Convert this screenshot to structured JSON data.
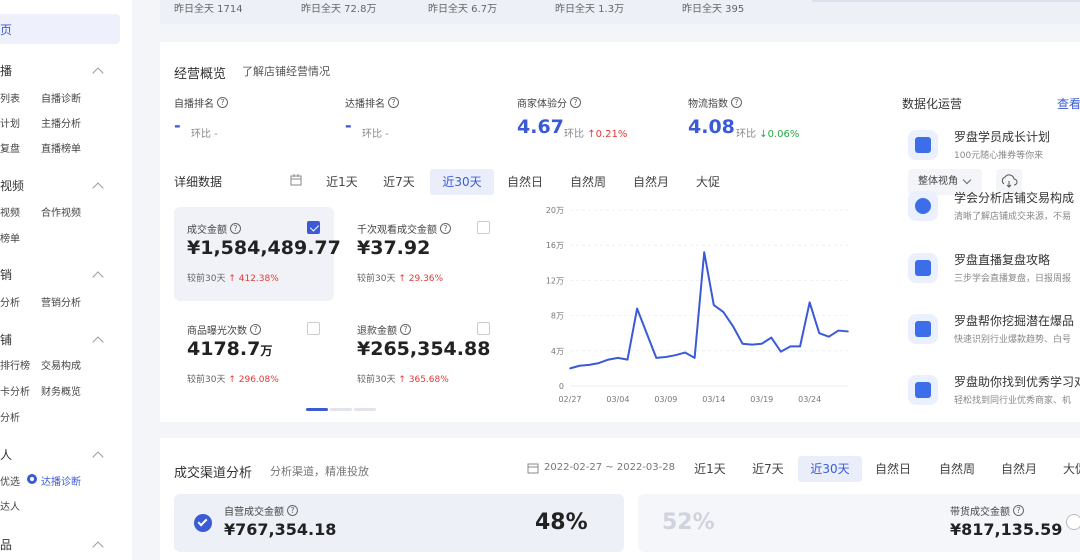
{
  "sidebar": {
    "active_item": "页",
    "sections": [
      {
        "title": "播",
        "items": [
          "列表",
          "自播诊断",
          "计划",
          "主播分析",
          "复盘",
          "直播榜单"
        ]
      },
      {
        "title": "视频",
        "items": [
          "视频",
          "合作视频",
          "榜单"
        ]
      },
      {
        "title": "销",
        "items": [
          "分析",
          "营销分析"
        ]
      },
      {
        "title": "铺",
        "items": [
          "排行榜",
          "交易构成",
          "卡分析",
          "财务概览",
          "分析"
        ]
      },
      {
        "title": "人",
        "items": [
          "优选",
          "达播诊断",
          "达人"
        ]
      },
      {
        "title": "品",
        "items": []
      }
    ]
  },
  "top_stats": [
    "昨日全天 1714",
    "昨日全天 72.8万",
    "昨日全天 6.7万",
    "昨日全天 1.3万",
    "昨日全天 395"
  ],
  "overview": {
    "title": "经营概览",
    "link": "了解店铺经营情况",
    "kpis": [
      {
        "label": "自播排名",
        "value": "-",
        "ring": "环比 -"
      },
      {
        "label": "达播排名",
        "value": "-",
        "ring": "环比 -"
      },
      {
        "label": "商家体验分",
        "value": "4.67",
        "ring_label": "环比",
        "change": "0.21%",
        "dir": "up"
      },
      {
        "label": "物流指数",
        "value": "4.08",
        "ring_label": "环比",
        "change": "0.06%",
        "dir": "down"
      }
    ]
  },
  "detail": {
    "title": "详细数据",
    "tabs": [
      "近1天",
      "近7天",
      "近30天",
      "自然日",
      "自然周",
      "自然月",
      "大促"
    ],
    "active_tab": "近30天",
    "view_select": "整体视角",
    "metrics": [
      {
        "label": "成交金额",
        "value": "¥1,584,489.77",
        "unit": "",
        "cmp": "较前30天",
        "change": "412.38%",
        "checked": true
      },
      {
        "label": "千次观看成交金额",
        "value": "¥37.92",
        "unit": "",
        "cmp": "较前30天",
        "change": "29.36%",
        "checked": false
      },
      {
        "label": "商品曝光次数",
        "value": "4178.7",
        "unit": "万",
        "cmp": "较前30天",
        "change": "296.08%",
        "checked": false
      },
      {
        "label": "退款金额",
        "value": "¥265,354.88",
        "unit": "",
        "cmp": "较前30天",
        "change": "365.68%",
        "checked": false
      }
    ]
  },
  "chart_data": {
    "type": "line",
    "x": [
      "02/27",
      "02/28",
      "03/01",
      "03/02",
      "03/03",
      "03/04",
      "03/05",
      "03/06",
      "03/07",
      "03/08",
      "03/09",
      "03/10",
      "03/11",
      "03/12",
      "03/13",
      "03/14",
      "03/15",
      "03/16",
      "03/17",
      "03/18",
      "03/19",
      "03/20",
      "03/21",
      "03/22",
      "03/23",
      "03/24",
      "03/25",
      "03/26",
      "03/27",
      "03/28"
    ],
    "x_tick_labels": [
      "02/27",
      "03/04",
      "03/09",
      "03/14",
      "03/19",
      "03/24"
    ],
    "y_ticks": [
      "0",
      "4万",
      "8万",
      "12万",
      "16万",
      "20万"
    ],
    "series": [
      {
        "values": [
          20000,
          23000,
          24000,
          26000,
          30000,
          32000,
          30000,
          88000,
          60000,
          32000,
          33000,
          35000,
          38000,
          32000,
          152000,
          92000,
          84000,
          68000,
          48000,
          47000,
          48000,
          55000,
          39000,
          45000,
          45000,
          95000,
          60000,
          56000,
          63000,
          62000
        ]
      }
    ],
    "ylim": [
      0,
      200000
    ],
    "color": "#3b5bd6"
  },
  "right_panel": {
    "title": "数据化运营",
    "link": "查看",
    "items": [
      {
        "title": "罗盘学员成长计划",
        "desc": "100元随心推券等你来",
        "icon": "chart-trend-icon"
      },
      {
        "title": "学会分析店铺交易构成",
        "desc": "清晰了解店铺成交来源，不易",
        "icon": "pie-chart-icon"
      },
      {
        "title": "罗盘直播复盘攻略",
        "desc": "三步学会直播复盘，日报周报",
        "icon": "document-icon"
      },
      {
        "title": "罗盘帮你挖掘潜在爆品",
        "desc": "快速识别行业爆款趋势、白号",
        "icon": "shopping-bag-icon"
      },
      {
        "title": "罗盘助你找到优秀学习对",
        "desc": "轻松找到同行业优秀商家、机",
        "icon": "store-icon"
      }
    ]
  },
  "channel": {
    "title": "成交渠道分析",
    "subtitle": "分析渠道，精准投放",
    "date_range": "2022-02-27 ~ 2022-03-28",
    "tabs": [
      "近1天",
      "近7天",
      "近30天",
      "自然日",
      "自然周",
      "自然月",
      "大促"
    ],
    "active_tab": "近30天",
    "left": {
      "label": "自营成交金额",
      "value": "¥767,354.18",
      "share": "48%"
    },
    "right": {
      "label": "带货成交金额",
      "value": "¥817,135.59",
      "share": "52%"
    }
  },
  "colors": {
    "accent": "#3b5bd6",
    "up": "#e53935",
    "down": "#27a744"
  }
}
